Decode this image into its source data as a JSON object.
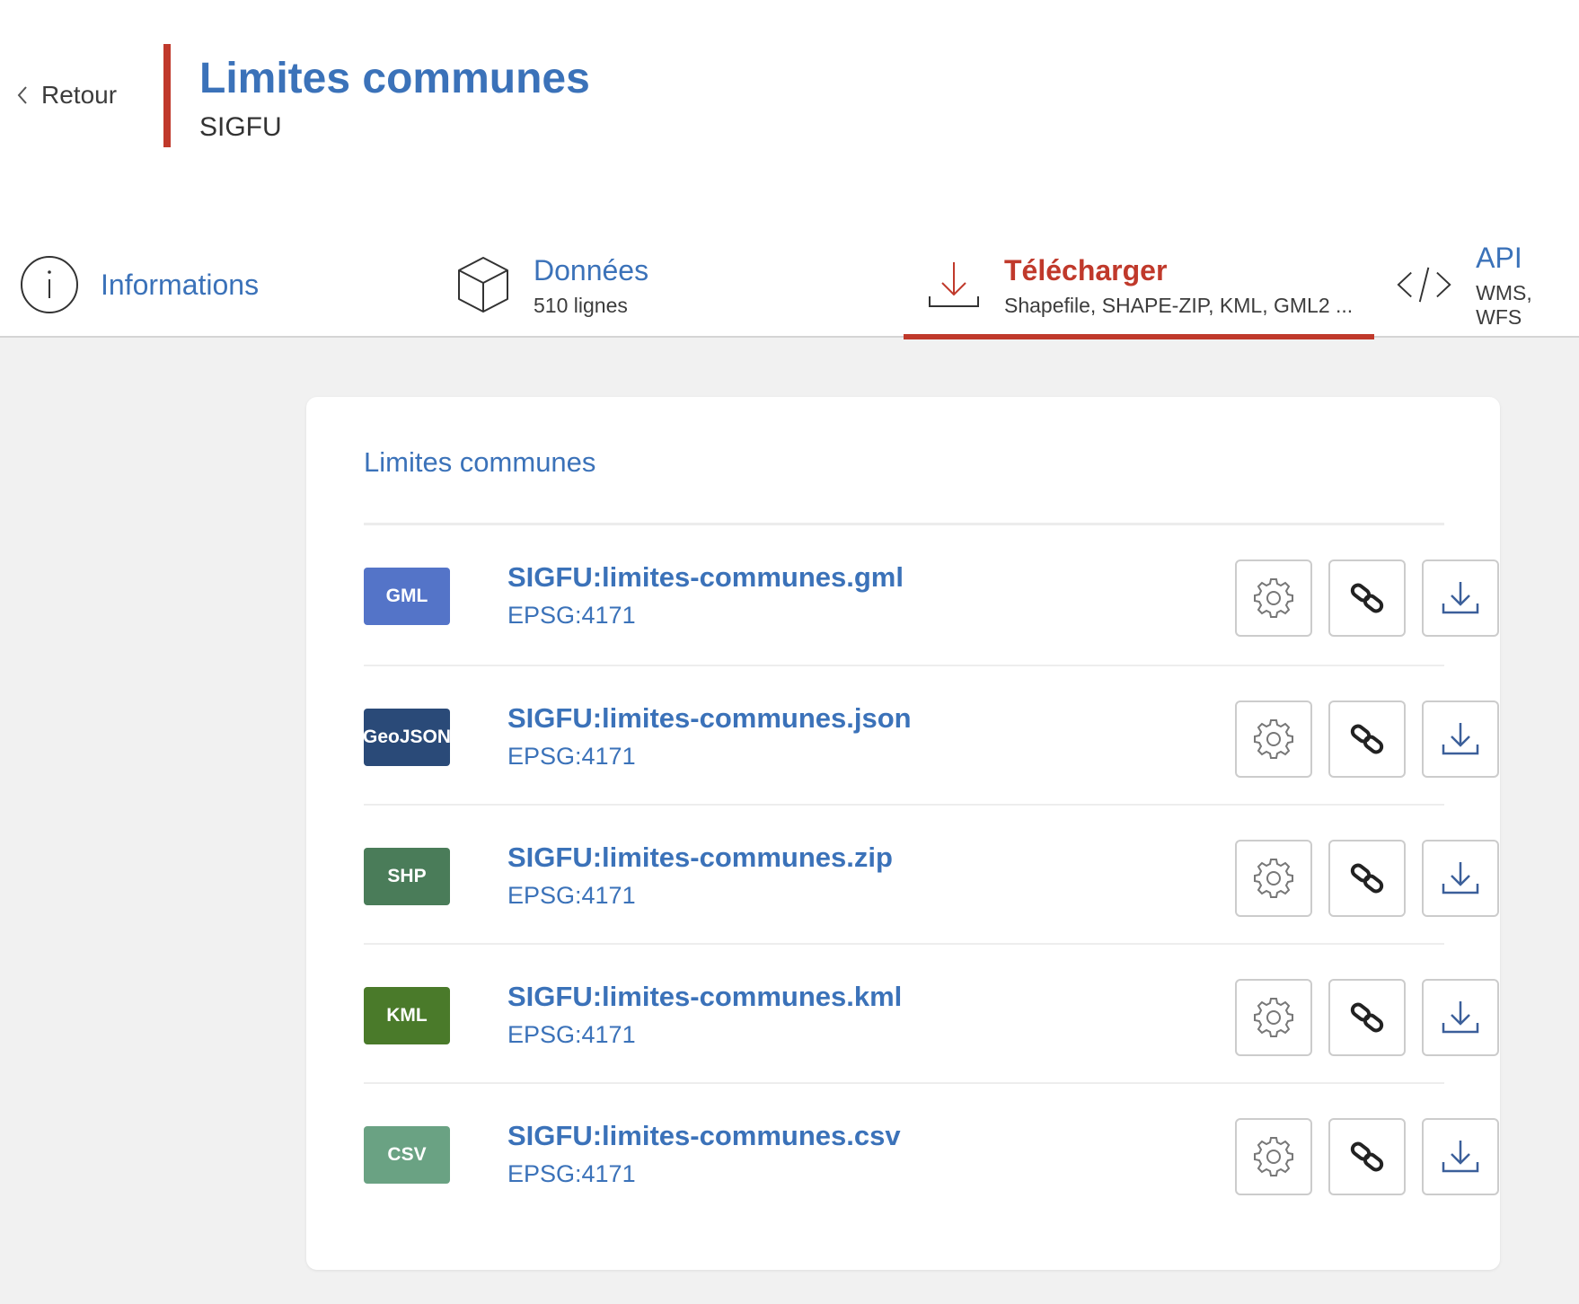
{
  "header": {
    "back_label": "Retour",
    "title": "Limites communes",
    "subtitle": "SIGFU"
  },
  "tabs": [
    {
      "label": "Informations",
      "sub": "",
      "icon": "info-icon",
      "active": false
    },
    {
      "label": "Données",
      "sub": "510 lignes",
      "icon": "cube-icon",
      "active": false
    },
    {
      "label": "Télécharger",
      "sub": "Shapefile, SHAPE-ZIP, KML, GML2 ...",
      "icon": "download-icon",
      "active": true
    },
    {
      "label": "API",
      "sub": "WMS, WFS",
      "icon": "code-icon",
      "active": false
    }
  ],
  "card": {
    "title": "Limites communes"
  },
  "files": [
    {
      "format": "GML",
      "badge_color": "#5474c8",
      "name": "SIGFU:limites-communes.gml",
      "crs": "EPSG:4171"
    },
    {
      "format": "GeoJSON",
      "badge_color": "#2a4a78",
      "name": "SIGFU:limites-communes.json",
      "crs": "EPSG:4171"
    },
    {
      "format": "SHP",
      "badge_color": "#4a7c59",
      "name": "SIGFU:limites-communes.zip",
      "crs": "EPSG:4171"
    },
    {
      "format": "KML",
      "badge_color": "#4a7a2a",
      "name": "SIGFU:limites-communes.kml",
      "crs": "EPSG:4171"
    },
    {
      "format": "CSV",
      "badge_color": "#6aa283",
      "name": "SIGFU:limites-communes.csv",
      "crs": "EPSG:4171"
    }
  ],
  "row_actions": [
    "gear-icon",
    "link-icon",
    "download-icon"
  ],
  "colors": {
    "accent_blue": "#3b72b9",
    "accent_red": "#c0392b",
    "page_bg": "#f1f1f1"
  }
}
